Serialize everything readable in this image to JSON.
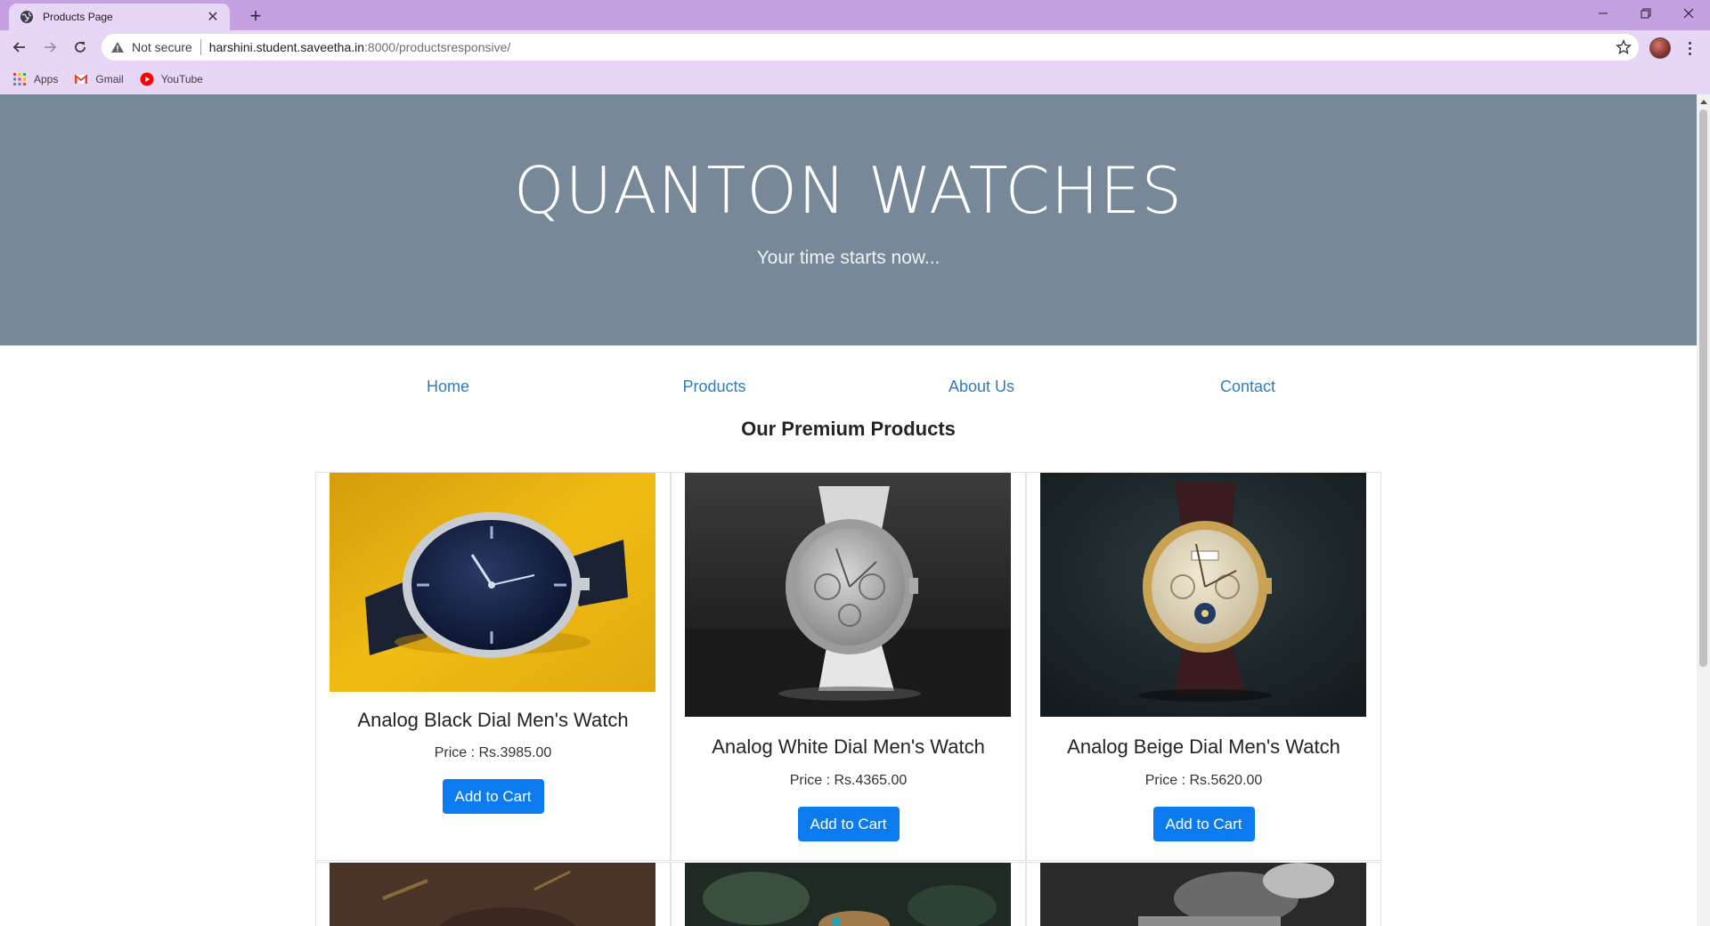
{
  "browser": {
    "tab_title": "Products Page",
    "security_label": "Not secure",
    "url_host": "harshini.student.saveetha.in",
    "url_path": ":8000/productsresponsive/",
    "bookmarks": [
      {
        "label": "Apps",
        "icon": "apps-grid-icon"
      },
      {
        "label": "Gmail",
        "icon": "gmail-icon"
      },
      {
        "label": "YouTube",
        "icon": "youtube-icon"
      }
    ]
  },
  "hero": {
    "title": "QUANTON WATCHES",
    "subtitle": "Your time starts now...",
    "background": "#778899"
  },
  "nav": [
    "Home",
    "Products",
    "About Us",
    "Contact"
  ],
  "section_title": "Our Premium Products",
  "products": [
    {
      "name": "Analog Black Dial Men's Watch",
      "price": "Price : Rs.3985.00",
      "button": "Add to Cart",
      "image": "watch-black-dial-on-yellow"
    },
    {
      "name": "Analog White Dial Men's Watch",
      "price": "Price : Rs.4365.00",
      "button": "Add to Cart",
      "image": "watch-white-dial-on-dark"
    },
    {
      "name": "Analog Beige Dial Men's Watch",
      "price": "Price : Rs.5620.00",
      "button": "Add to Cart",
      "image": "watch-beige-dial-gold"
    }
  ],
  "colors": {
    "link": "#2f7bbf",
    "button": "#0d7bf0",
    "chrome": "#c5a1e4",
    "toolbar": "#e7d6f5"
  }
}
